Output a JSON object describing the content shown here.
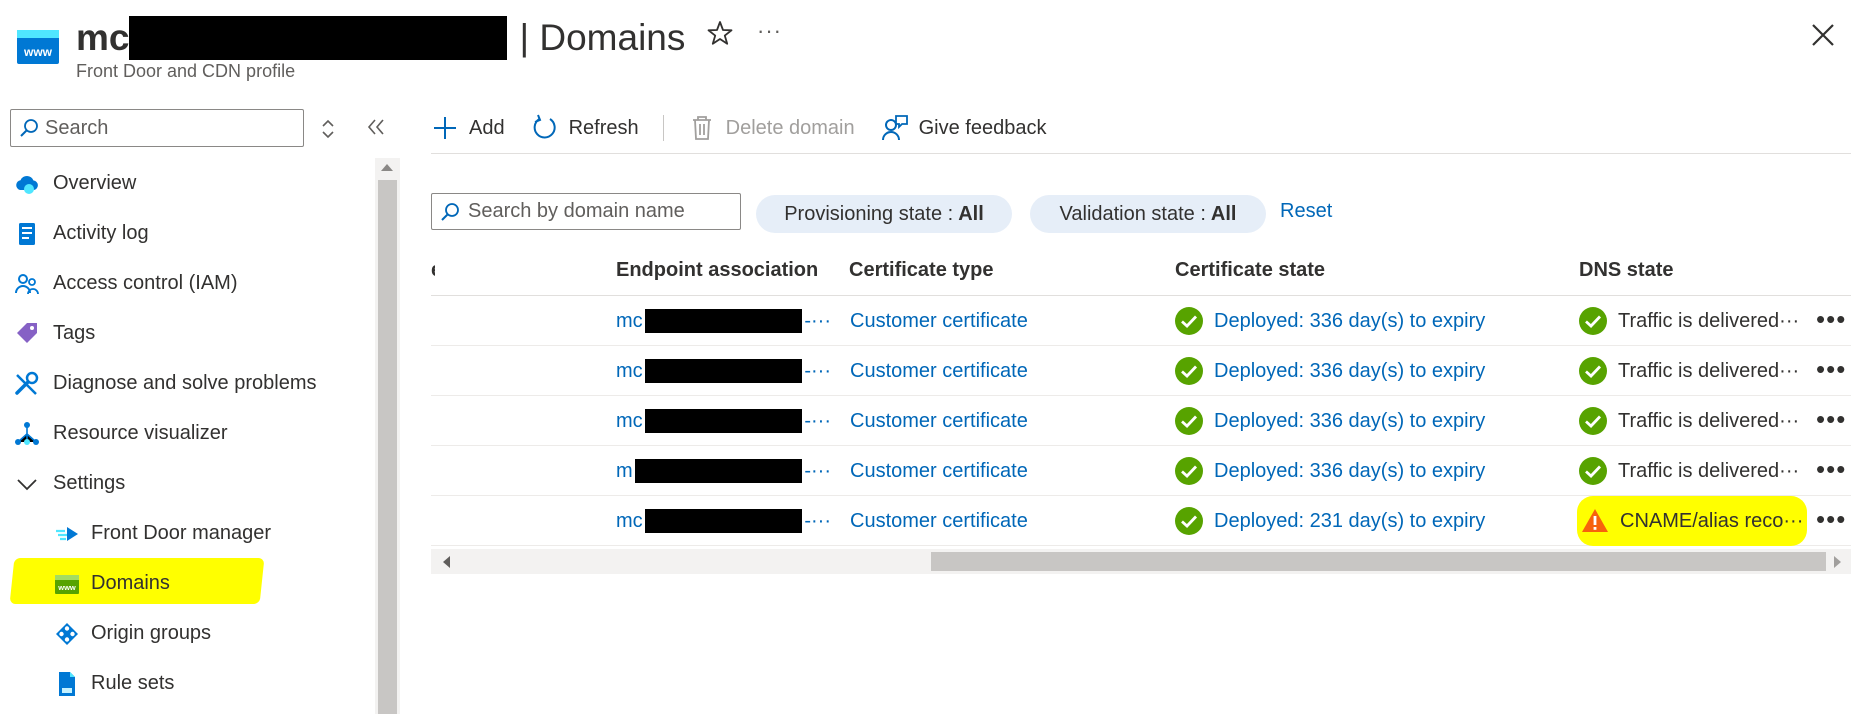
{
  "header": {
    "title_prefix": "mc",
    "title_separator": "| Domains",
    "subtitle": "Front Door and CDN profile",
    "more_label": "···"
  },
  "sidebar": {
    "search_placeholder": "Search",
    "items": [
      {
        "label": "Overview",
        "icon": "overview-cloud-icon"
      },
      {
        "label": "Activity log",
        "icon": "activity-log-icon"
      },
      {
        "label": "Access control (IAM)",
        "icon": "people-icon"
      },
      {
        "label": "Tags",
        "icon": "tag-icon"
      },
      {
        "label": "Diagnose and solve problems",
        "icon": "wrench-icon"
      },
      {
        "label": "Resource visualizer",
        "icon": "network-icon"
      },
      {
        "label": "Settings",
        "icon": "chevron-down-icon"
      },
      {
        "label": "Front Door manager",
        "icon": "front-door-icon"
      },
      {
        "label": "Domains",
        "icon": "www-icon",
        "active": true
      },
      {
        "label": "Origin groups",
        "icon": "origin-groups-icon"
      },
      {
        "label": "Rule sets",
        "icon": "document-icon"
      }
    ]
  },
  "toolbar": {
    "add": "Add",
    "refresh": "Refresh",
    "delete": "Delete domain",
    "feedback": "Give feedback"
  },
  "filters": {
    "search_placeholder": "Search by domain name",
    "provisioning_label": "Provisioning state :",
    "provisioning_value": "All",
    "validation_label": "Validation state :",
    "validation_value": "All",
    "reset": "Reset"
  },
  "table": {
    "columns": {
      "truncated": "e",
      "endpoint": "Endpoint association",
      "cert_type": "Certificate type",
      "cert_state": "Certificate state",
      "dns_state": "DNS state"
    },
    "rows": [
      {
        "endpoint_prefix": "mc",
        "endpoint_suffix": "-···",
        "cert_type": "Customer certificate",
        "cert_state": "Deployed: 336 day(s) to expiry",
        "dns_state": "Traffic is delivered···",
        "dns_status": "success"
      },
      {
        "endpoint_prefix": "mc",
        "endpoint_suffix": "-···",
        "cert_type": "Customer certificate",
        "cert_state": "Deployed: 336 day(s) to expiry",
        "dns_state": "Traffic is delivered···",
        "dns_status": "success"
      },
      {
        "endpoint_prefix": "mc",
        "endpoint_suffix": "-···",
        "cert_type": "Customer certificate",
        "cert_state": "Deployed: 336 day(s) to expiry",
        "dns_state": "Traffic is delivered···",
        "dns_status": "success"
      },
      {
        "endpoint_prefix": "m",
        "endpoint_suffix": "-···",
        "cert_type": "Customer certificate",
        "cert_state": "Deployed: 336 day(s) to expiry",
        "dns_state": "Traffic is delivered···",
        "dns_status": "success"
      },
      {
        "endpoint_prefix": "mc",
        "endpoint_suffix": "-···",
        "cert_type": "Customer certificate",
        "cert_state": "Deployed: 231 day(s) to expiry",
        "dns_state": "CNAME/alias reco···",
        "dns_status": "warning"
      }
    ],
    "row_more_label": "•••"
  },
  "colors": {
    "link": "#0067b8",
    "success": "#57a300",
    "warning": "#f7630c",
    "highlight": "#ffff00",
    "pill": "#e6eef8"
  }
}
